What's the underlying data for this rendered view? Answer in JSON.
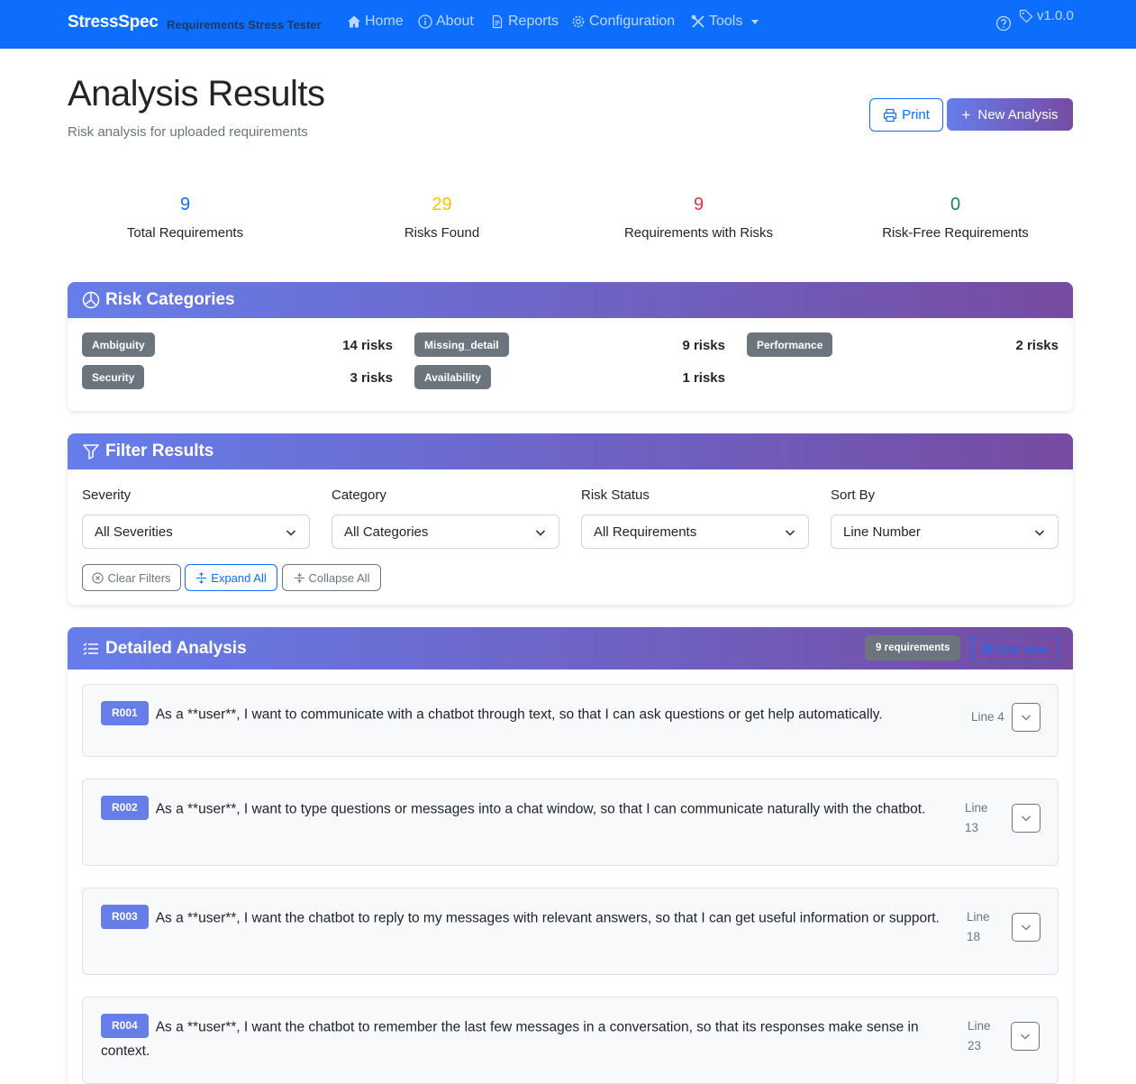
{
  "nav": {
    "brand": "StressSpec",
    "brand_sub": "Requirements Stress Tester",
    "links": [
      {
        "label": "Home",
        "icon": "home-icon"
      },
      {
        "label": "About",
        "icon": "info-icon"
      },
      {
        "label": "Reports",
        "icon": "file-icon"
      },
      {
        "label": "Configuration",
        "icon": "gear-icon"
      },
      {
        "label": "Tools",
        "icon": "tools-icon"
      }
    ],
    "version": "v1.0.0"
  },
  "header": {
    "title": "Analysis Results",
    "subtitle": "Risk analysis for uploaded requirements",
    "print_label": "Print",
    "new_label": "New Analysis"
  },
  "stats": [
    {
      "value": "9",
      "label": "Total Requirements",
      "color": "#0d6efd"
    },
    {
      "value": "29",
      "label": "Risks Found",
      "color": "#ffc107"
    },
    {
      "value": "9",
      "label": "Requirements with Risks",
      "color": "#dc3545"
    },
    {
      "value": "0",
      "label": "Risk-Free Requirements",
      "color": "#198754"
    }
  ],
  "risk_categories": {
    "title": "Risk Categories",
    "items": [
      {
        "name": "Ambiguity",
        "count": "14 risks"
      },
      {
        "name": "Missing_detail",
        "count": "9 risks"
      },
      {
        "name": "Performance",
        "count": "2 risks"
      },
      {
        "name": "Security",
        "count": "3 risks"
      },
      {
        "name": "Availability",
        "count": "1 risks"
      }
    ]
  },
  "filters": {
    "title": "Filter Results",
    "fields": [
      {
        "label": "Severity",
        "value": "All Severities"
      },
      {
        "label": "Category",
        "value": "All Categories"
      },
      {
        "label": "Risk Status",
        "value": "All Requirements"
      },
      {
        "label": "Sort By",
        "value": "Line Number"
      }
    ],
    "clear_label": "Clear Filters",
    "expand_label": "Expand All",
    "collapse_label": "Collapse All"
  },
  "analysis": {
    "title": "Detailed Analysis",
    "count_label": "9 requirements",
    "grid_label": "Grid View",
    "requirements": [
      {
        "id": "R001",
        "text": "As a **user**, I want to communicate with a chatbot through text, so that I can ask questions or get help automatically.",
        "line_label": "Line",
        "line_number": "4"
      },
      {
        "id": "R002",
        "text": "As a **user**, I want to type questions or messages into a chat window, so that I can communicate naturally with the chatbot.",
        "line_label": "Line",
        "line_number": "13"
      },
      {
        "id": "R003",
        "text": "As a **user**, I want the chatbot to reply to my messages with relevant answers, so that I can get useful information or support.",
        "line_label": "Line",
        "line_number": "18"
      },
      {
        "id": "R004",
        "text": "As a **user**, I want the chatbot to remember the last few messages in a conversation, so that its responses make sense in context.",
        "line_label": "Line",
        "line_number": "23"
      }
    ]
  }
}
